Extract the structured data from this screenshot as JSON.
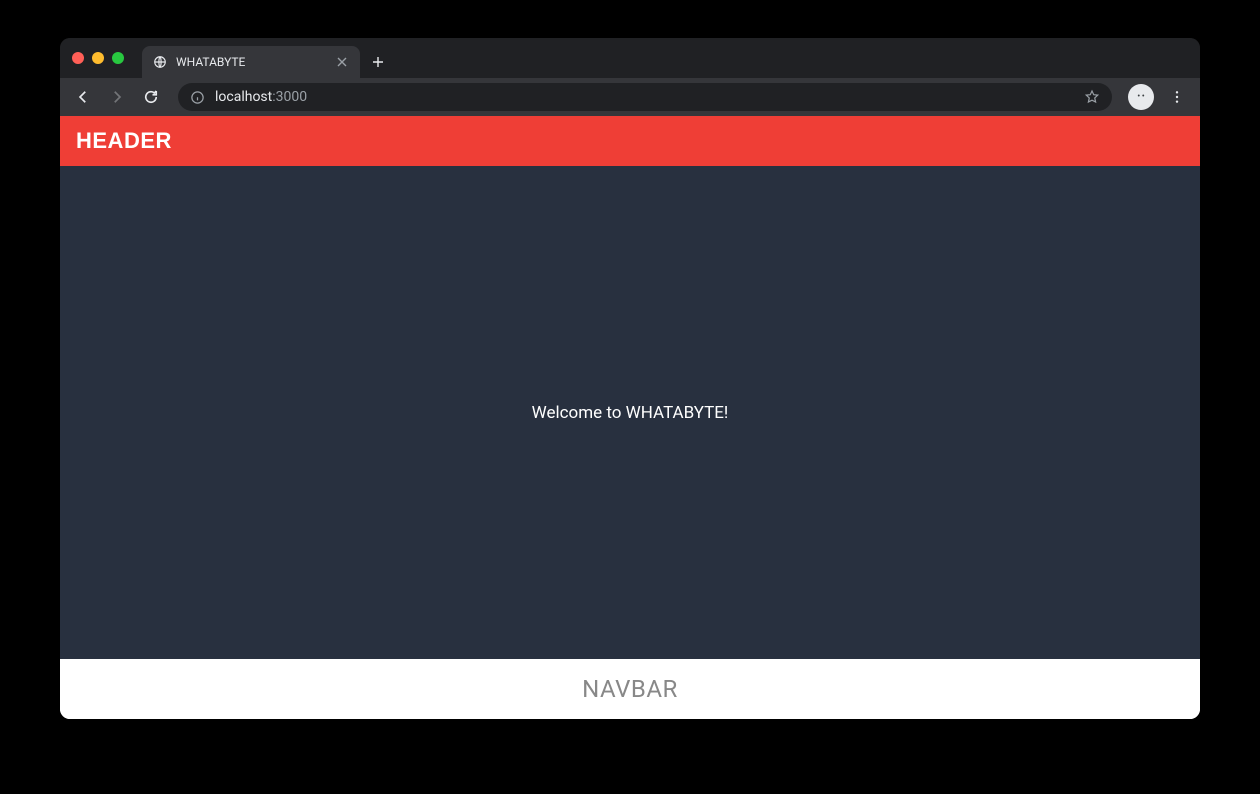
{
  "browser": {
    "tab_title": "WHATABYTE",
    "url_host": "localhost",
    "url_port": ":3000"
  },
  "page": {
    "header_text": "HEADER",
    "welcome_text": "Welcome to WHATABYTE!",
    "navbar_text": "NAVBAR"
  },
  "colors": {
    "header_bg": "#ef3e36",
    "content_bg": "#28303f",
    "navbar_bg": "#ffffff",
    "navbar_fg": "#888888"
  }
}
